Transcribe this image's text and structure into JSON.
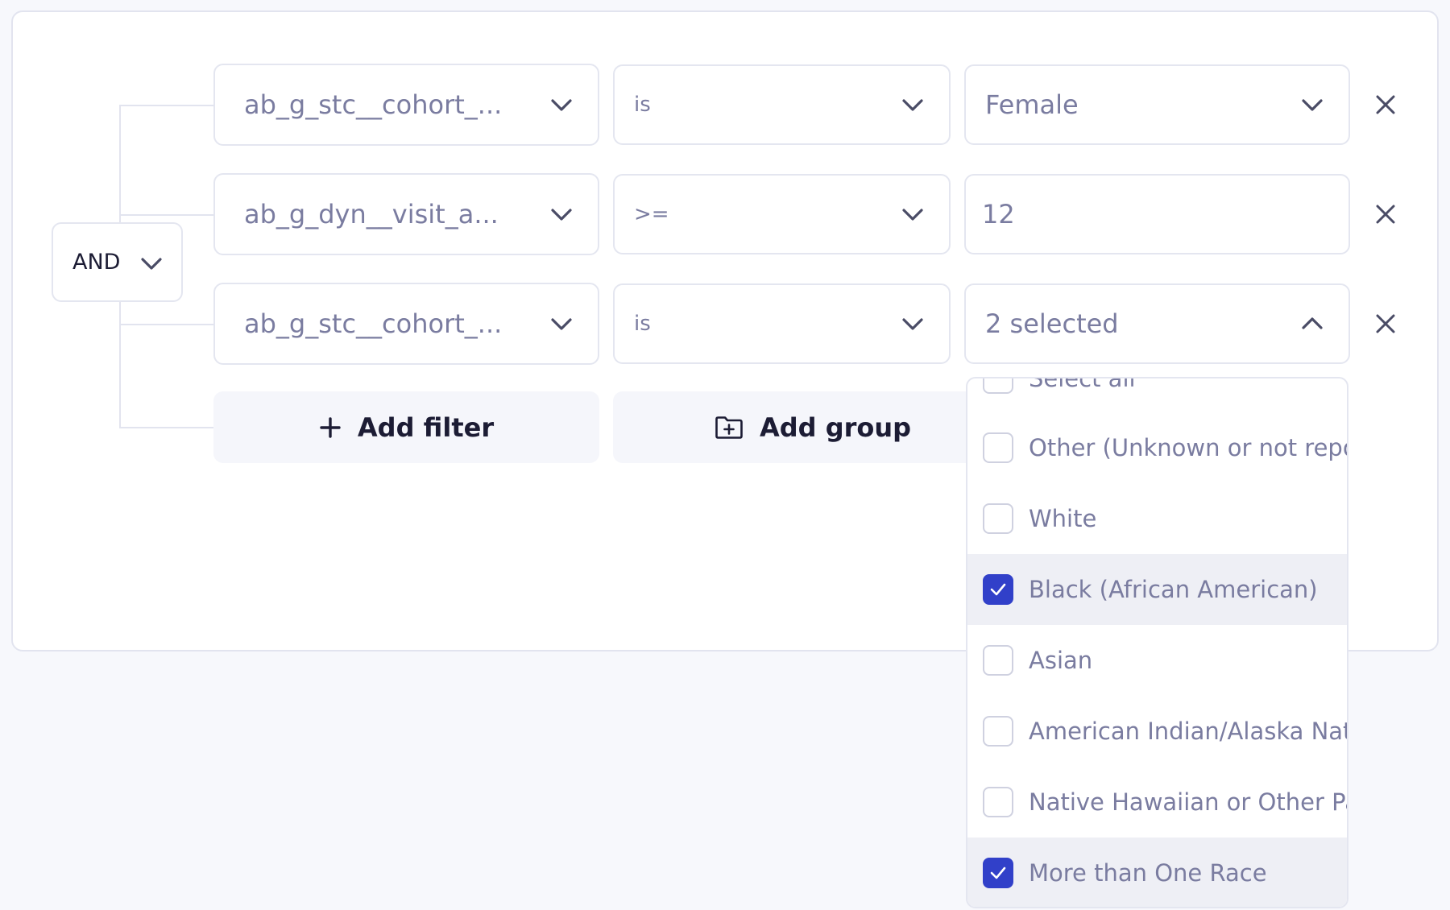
{
  "group": {
    "operator": "AND"
  },
  "filters": [
    {
      "field": "ab_g_stc__cohort_...",
      "operator": "is",
      "value": "Female",
      "value_type": "select"
    },
    {
      "field": "ab_g_dyn__visit_a...",
      "operator": ">=",
      "value": "12",
      "value_type": "input"
    },
    {
      "field": "ab_g_stc__cohort_...",
      "operator": "is",
      "value": "2 selected",
      "value_type": "multiselect-open"
    }
  ],
  "actions": {
    "add_filter": "Add filter",
    "add_group": "Add group"
  },
  "dropdown": {
    "options": [
      {
        "label": "Select all",
        "checked": false
      },
      {
        "label": "Other (Unknown or not reported)",
        "checked": false
      },
      {
        "label": "White",
        "checked": false
      },
      {
        "label": "Black (African American)",
        "checked": true
      },
      {
        "label": "Asian",
        "checked": false
      },
      {
        "label": "American Indian/Alaska Native",
        "checked": false
      },
      {
        "label": "Native Hawaiian or Other Pacific Islander",
        "checked": false
      },
      {
        "label": "More than One Race",
        "checked": true
      }
    ]
  },
  "colors": {
    "accent": "#3140c9",
    "text": "#7a7ca0",
    "border": "#e4e6f0",
    "page_bg": "#f7f8fc",
    "button_bg": "#f5f6fb"
  }
}
